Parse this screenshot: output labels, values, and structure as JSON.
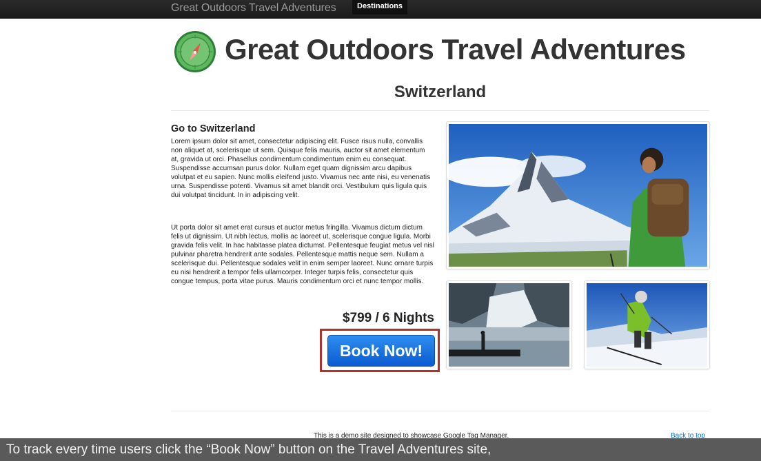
{
  "navbar": {
    "brand": "Great Outdoors Travel Adventures",
    "tab": "Destinations"
  },
  "header": {
    "site_title": "Great Outdoors Travel Adventures",
    "logo_icon": "compass-icon",
    "page_title": "Switzerland"
  },
  "article": {
    "heading": "Go to Switzerland",
    "paragraphs": [
      "Lorem ipsum dolor sit amet, consectetur adipiscing elit. Fusce risus nulla, convallis non aliquet at, scelerisque ut sem. Quisque felis mauris, auctor sit amet elementum at, gravida ut orci. Phasellus condimentum condimentum enim eu consequat. Suspendisse accumsan purus dolor. Nullam eget quam dignissim arcu dapibus volutpat et eu sapien. Nunc mollis eleifend justo. Vivamus nec ante nisi, eu venenatis urna. Suspendisse potenti. Vivamus sit amet blandit orci. Vestibulum quis ligula quis dui volutpat tincidunt. In in adipiscing velit.",
      "Ut porta dolor sit amet erat cursus et auctor metus fringilla. Vivamus dictum dictum felis ut dignissim. Ut nibh lectus, mollis ac laoreet ut, scelerisque congue ligula. Morbi gravida felis velit. In hac habitasse platea dictumst. Pellentesque feugiat metus vel nisl pulvinar pharetra hendrerit ante sodales. Pellentesque mattis neque sem. Nullam a scelerisque dui. Pellentesque sodales velit in enim semper laoreet. Nunc ornare turpis eu nisi hendrerit a tempor felis ullamcorper. Integer turpis felis, consectetur quis congue tempus, porta vitae purus. Mauris condimentum orci et nunc tempor mollis."
    ],
    "price": "$799 / 6 Nights",
    "book_label": "Book Now!"
  },
  "colors": {
    "book_button": "#1a6fe0",
    "highlight_border": "#b2322a",
    "navbar": "#222222"
  },
  "footer": {
    "text": "This is a demo site designed to showcase Google Tag Manager.",
    "back_to_top": "Back to top"
  },
  "caption": {
    "text": "To track every time users click the “Book Now” button on the Travel Adventures site,"
  }
}
